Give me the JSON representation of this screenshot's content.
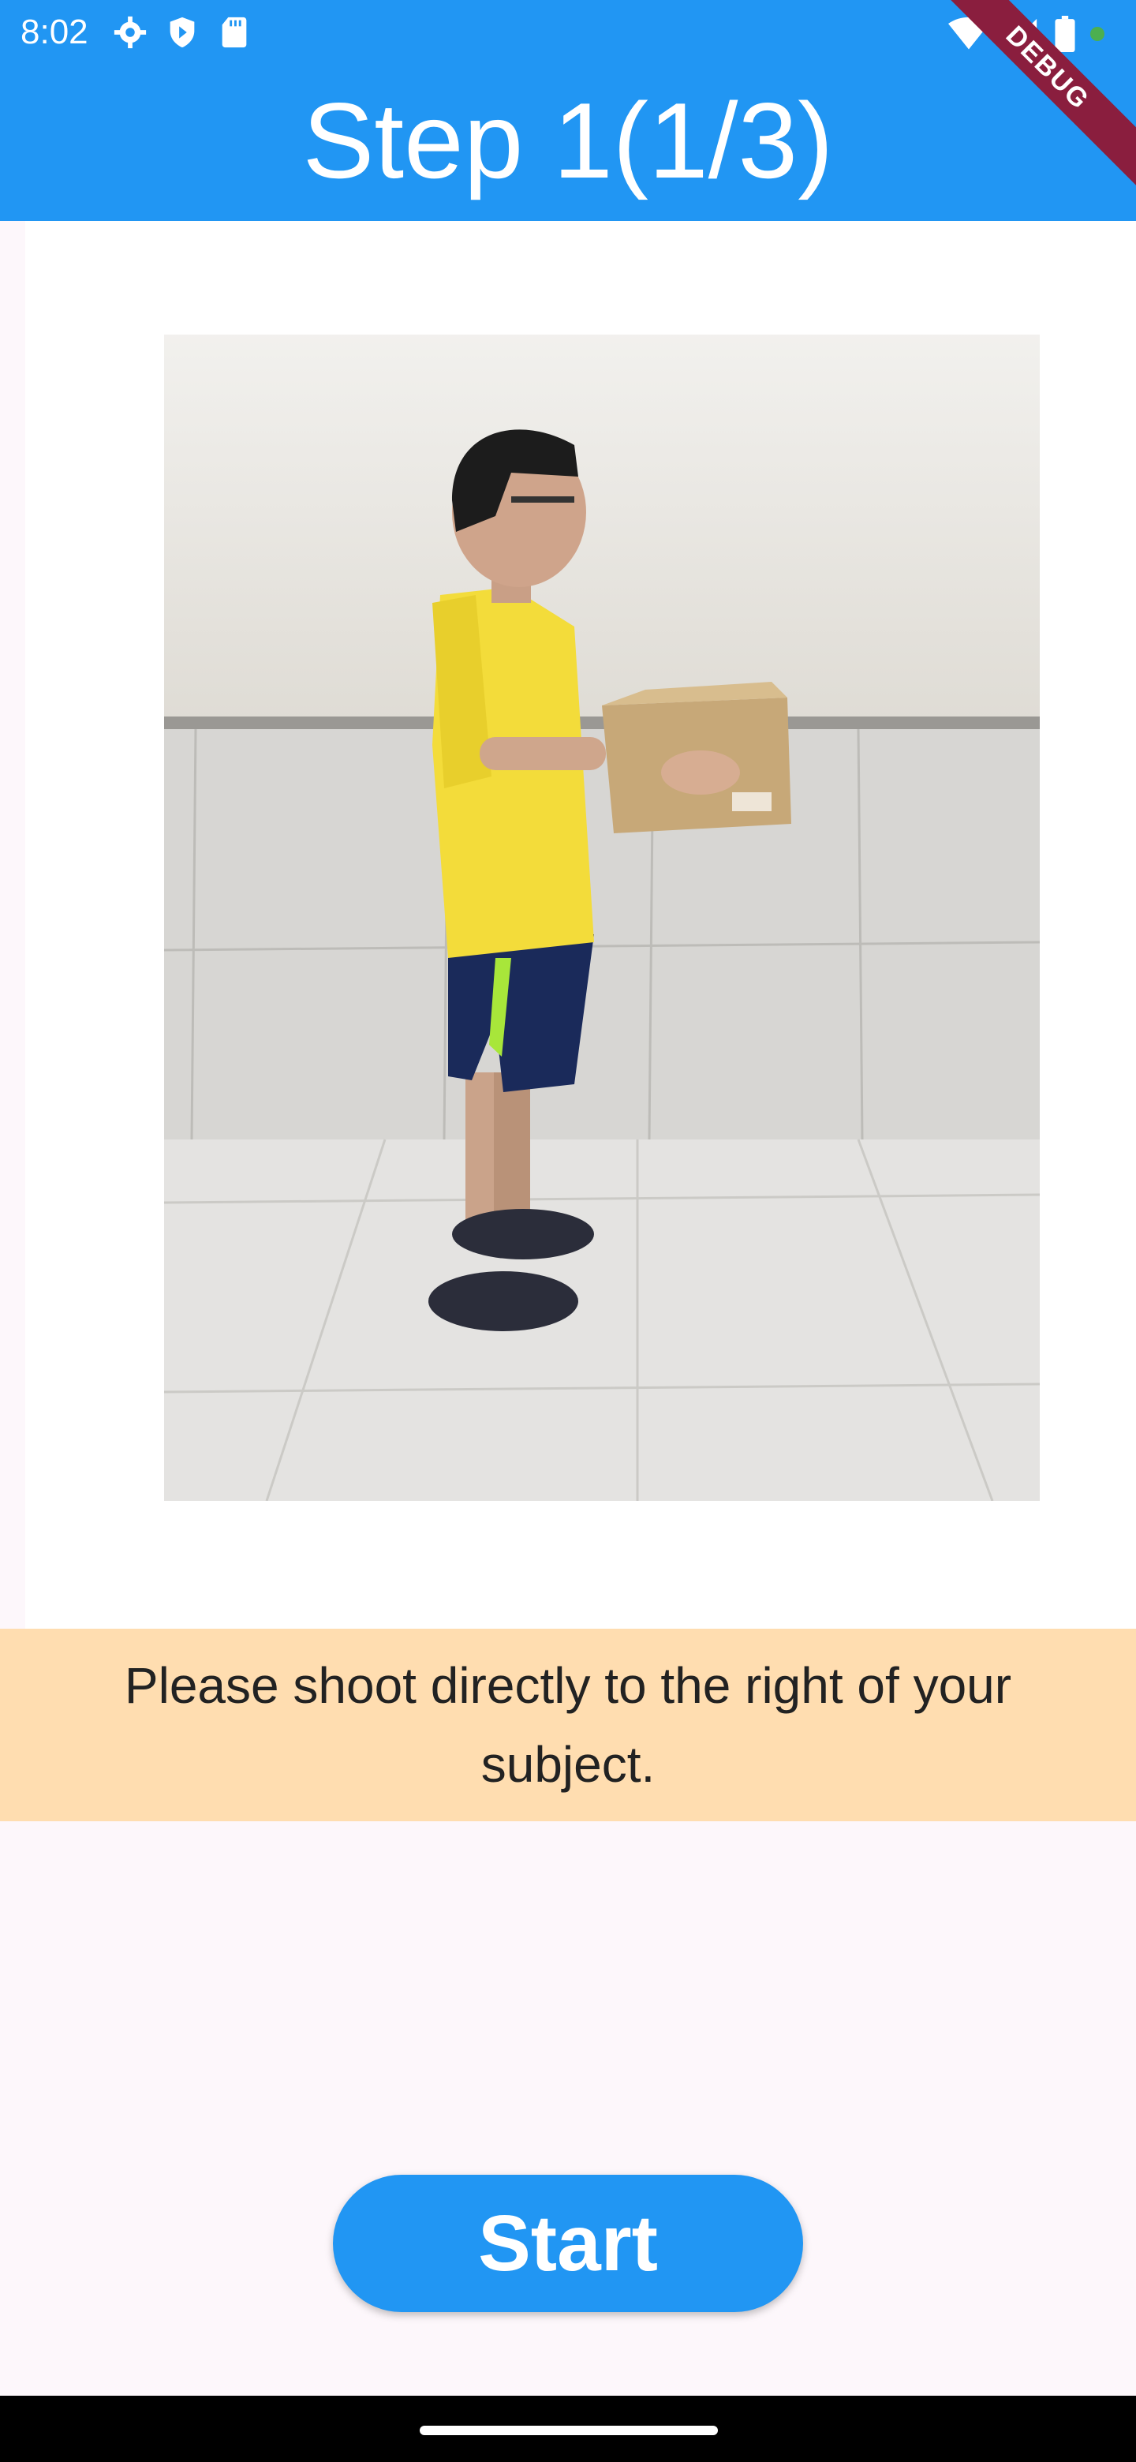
{
  "status_bar": {
    "time": "8:02",
    "left_icons": [
      "settings-icon",
      "shield-icon",
      "sd-card-icon"
    ],
    "right_icons": [
      "wifi-icon",
      "signal-icon",
      "battery-icon"
    ]
  },
  "app_bar": {
    "title": "Step 1(1/3)",
    "background": "#2196f3",
    "debug_banner": "DEBUG"
  },
  "photo": {
    "description_icon": "person-holding-box-photo"
  },
  "instruction": {
    "text": "Please shoot directly to the right of your subject.",
    "background": "#ffddb0"
  },
  "start_button": {
    "label": "Start",
    "color": "#2196f3"
  }
}
